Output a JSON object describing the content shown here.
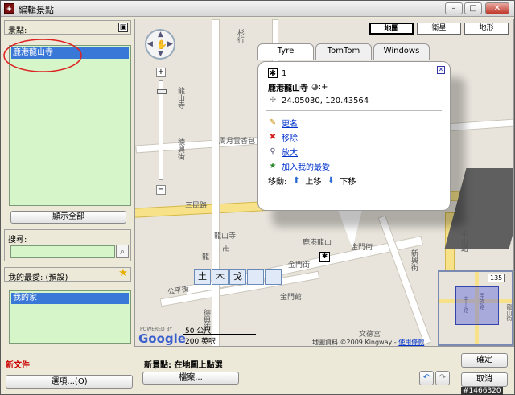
{
  "window": {
    "title": "編輯景點",
    "app_icon": "app-icon"
  },
  "titlebar": {
    "minimize": "–",
    "maximize": "□",
    "close": "✕"
  },
  "places": {
    "label": "景點:",
    "items": [
      "鹿港龍山寺"
    ]
  },
  "show_all_button": "顯示全部",
  "search": {
    "label": "搜尋:",
    "value": "",
    "button_icon": "magnifier-icon"
  },
  "favorites": {
    "label": "我的最愛: (預設)",
    "items": [
      "我的家"
    ]
  },
  "map": {
    "types": [
      "地圖",
      "衛星",
      "地形"
    ],
    "selected_type": "地圖",
    "street_labels": {
      "sanmin": "三民路",
      "jinmen1": "金門街",
      "jinmen2": "金門街",
      "gongping": "公平街",
      "zhongshan": "中山路",
      "dexing1": "德興街",
      "dexing2": "德興街",
      "xinxing": "新興街",
      "longshan": "龍山寺",
      "zhouyue": "周月雲香包",
      "longshan_map": "龍山寺",
      "lugang_longshan": "鹿港龍山",
      "jinmen_hall": "金門館",
      "wenwu": "文德宮",
      "shan": "杉行",
      "long": "龍"
    },
    "scale": {
      "top": "50 公尺",
      "bottom": "200 英呎"
    },
    "attribution": "地圖資料 ©2009 Kingway - ",
    "terms_link": "使用條款",
    "powered_by": "POWERED BY",
    "google": "Google",
    "mini_label": "135",
    "mini_streets": [
      "中山路",
      "民族路",
      "龍山街"
    ]
  },
  "info": {
    "tabs": [
      "Tyre",
      "TomTom",
      "Windows"
    ],
    "selected_tab": "Tyre",
    "number": "1",
    "name": "鹿港龍山寺",
    "name_suffix": ":+",
    "coords": "24.05030, 120.43564",
    "actions": [
      "更名",
      "移除",
      "放大",
      "加入我的最愛"
    ],
    "move_label": "移動:",
    "move_up": "上移",
    "move_down": "下移"
  },
  "keyboard": [
    "土",
    "木",
    "戈",
    "",
    ""
  ],
  "bottom": {
    "new_doc": "新文件",
    "options_button": "選項...(O)",
    "new_place_text": "新景點: 在地圖上點選",
    "file_button": "檔案...",
    "ok_button": "確定",
    "cancel_button": "取消",
    "watermark": "#1466320"
  },
  "colors": {
    "list_bg": "#d6f5c8",
    "selection": "#3a78d8",
    "link": "#0033cc",
    "new_doc": "#cc0000",
    "annotation_circle": "#dd2222"
  }
}
